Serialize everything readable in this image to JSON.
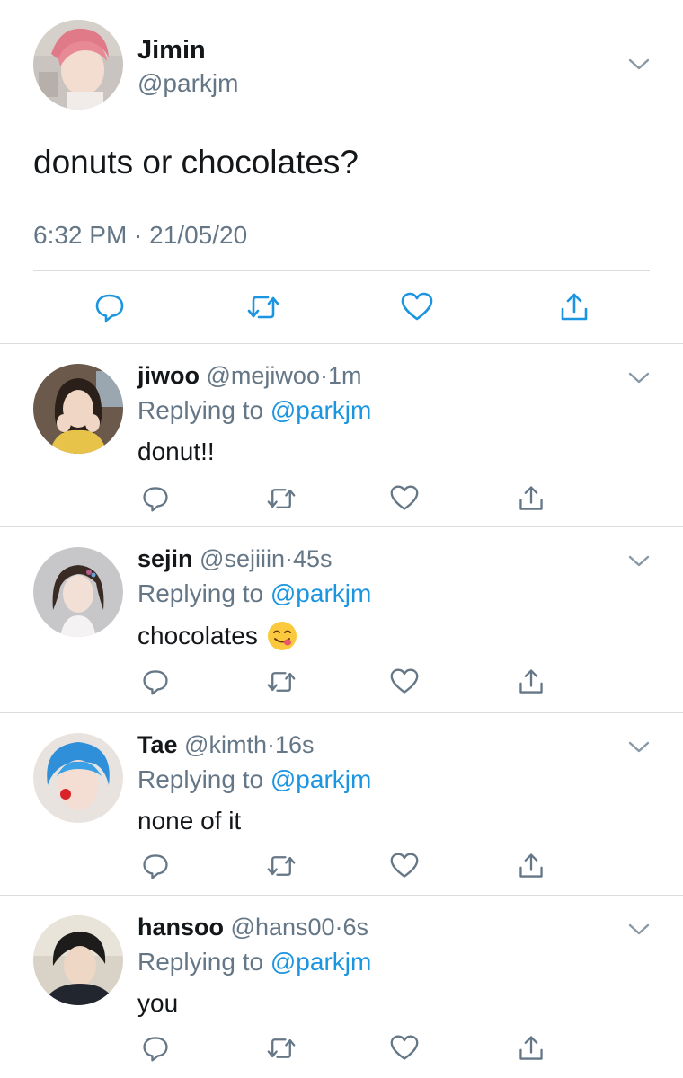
{
  "main_tweet": {
    "name": "Jimin",
    "handle": "@parkjm",
    "text": "donuts or chocolates?",
    "timestamp": "6:32 PM · 21/05/20"
  },
  "replies": [
    {
      "name": "jiwoo",
      "handle": "@mejiwoo",
      "dot": "·",
      "time": "1m",
      "replying_prefix": "Replying to",
      "replying_to": "@parkjm",
      "text": "donut!!"
    },
    {
      "name": "sejin",
      "handle": "@sejiiin",
      "dot": "·",
      "time": "45s",
      "replying_prefix": "Replying to",
      "replying_to": "@parkjm",
      "text": "chocolates"
    },
    {
      "name": "Tae",
      "handle": "@kimth",
      "dot": "·",
      "time": "16s",
      "replying_prefix": "Replying to",
      "replying_to": "@parkjm",
      "text": "none of it"
    },
    {
      "name": "hansoo",
      "handle": "@hans00",
      "dot": "·",
      "time": "6s",
      "replying_prefix": "Replying to",
      "replying_to": "@parkjm",
      "text": "you"
    }
  ],
  "icons": {
    "reply": "reply-icon",
    "retweet": "retweet-icon",
    "like": "heart-icon",
    "share": "share-icon",
    "menu": "chevron-down-icon",
    "emoji": "yum-face-emoji"
  },
  "colors": {
    "accent": "#1b95e0",
    "secondary_text": "#657786",
    "primary_text": "#14171a",
    "divider": "#d9dde0"
  }
}
